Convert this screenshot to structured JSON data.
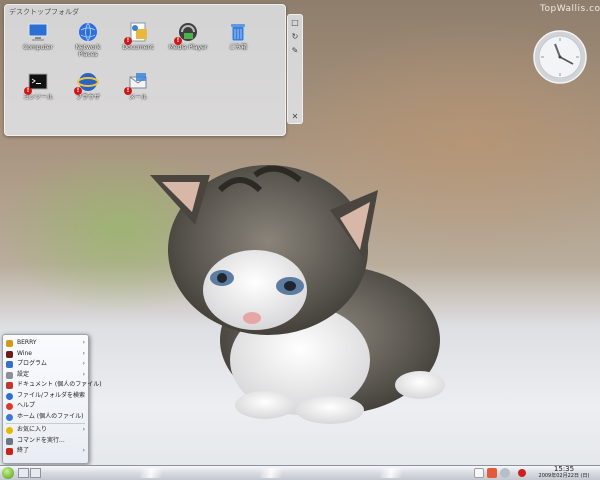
{
  "watermark": "TopWallis.com",
  "folder_view": {
    "title": "デスクトップフォルダ",
    "icons": [
      {
        "label": "Computer",
        "icon": "computer-icon"
      },
      {
        "label": "Network\nPlaces",
        "icon": "globe-icon"
      },
      {
        "label": "Document",
        "icon": "documents-icon"
      },
      {
        "label": "Media Player",
        "icon": "media-player-icon"
      },
      {
        "label": "ごみ箱",
        "icon": "trash-icon"
      },
      {
        "label": "コンソール",
        "icon": "console-icon"
      },
      {
        "label": "ブラウザ",
        "icon": "browser-icon"
      },
      {
        "label": "メール",
        "icon": "mail-icon"
      }
    ]
  },
  "handle": {
    "items": [
      "□",
      "↻",
      "✎",
      "✕"
    ]
  },
  "start_menu": {
    "items": [
      {
        "label": "BERRY",
        "icon": "berry-icon",
        "color": "#d19a1c",
        "submenu": true
      },
      {
        "label": "Wine",
        "icon": "wine-icon",
        "color": "#6f1b1b",
        "submenu": true
      },
      {
        "label": "プログラム",
        "icon": "programs-icon",
        "color": "#3a6fc4",
        "submenu": true
      },
      {
        "label": "設定",
        "icon": "settings-icon",
        "color": "#8a8f99",
        "submenu": true
      },
      {
        "label": "ドキュメント (個人のファイル)",
        "icon": "documents-icon",
        "color": "#c0392b",
        "submenu": true
      },
      {
        "label": "ファイル/フォルダを検索",
        "icon": "search-icon",
        "color": "#2c6ed5",
        "submenu": false
      },
      {
        "label": "ヘルプ",
        "icon": "help-icon",
        "color": "#d83a2a",
        "submenu": false
      },
      {
        "label": "ホーム (個人のファイル)",
        "icon": "home-icon",
        "color": "#3b78d8",
        "submenu": false
      },
      {
        "label": "お気に入り",
        "icon": "bookmarks-icon",
        "color": "#e6b800",
        "submenu": true
      },
      {
        "label": "コマンドを実行...",
        "icon": "run-command-icon",
        "color": "#6d7784",
        "submenu": false
      },
      {
        "label": "終了",
        "icon": "logout-icon",
        "color": "#c8241c",
        "submenu": true
      }
    ]
  },
  "taskbar": {
    "time": "15:35",
    "date": "2009年02月22日 (日)"
  }
}
